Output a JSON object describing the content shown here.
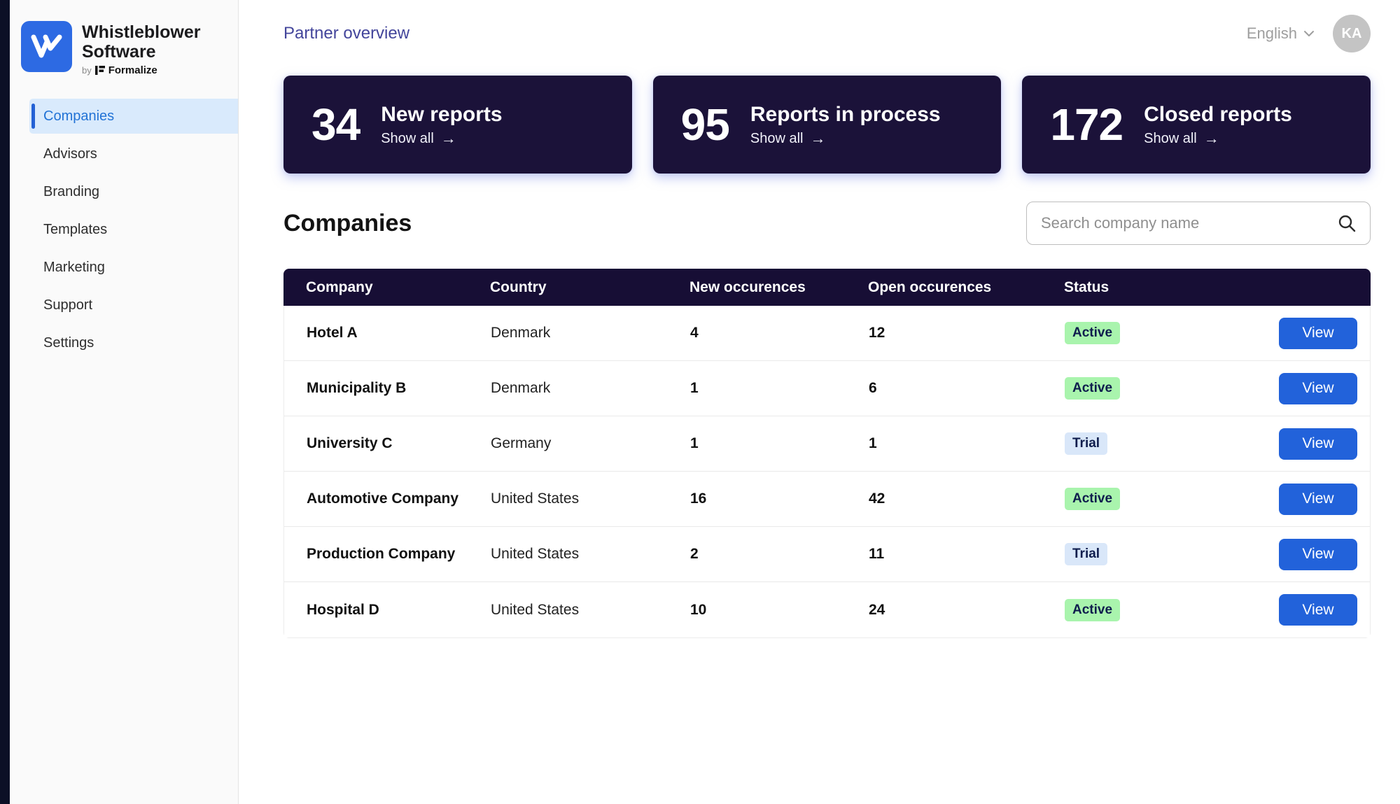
{
  "brand": {
    "name_line1": "Whistleblower",
    "name_line2": "Software",
    "byline_prefix": "by",
    "byline_brand": "Formalize"
  },
  "sidebar": {
    "items": [
      {
        "label": "Companies",
        "active": true
      },
      {
        "label": "Advisors",
        "active": false
      },
      {
        "label": "Branding",
        "active": false
      },
      {
        "label": "Templates",
        "active": false
      },
      {
        "label": "Marketing",
        "active": false
      },
      {
        "label": "Support",
        "active": false
      },
      {
        "label": "Settings",
        "active": false
      }
    ]
  },
  "header": {
    "breadcrumb": "Partner overview",
    "language": "English",
    "avatar_initials": "KA"
  },
  "stats": [
    {
      "value": "34",
      "label": "New reports",
      "link_label": "Show all"
    },
    {
      "value": "95",
      "label": "Reports in process",
      "link_label": "Show all"
    },
    {
      "value": "172",
      "label": "Closed reports",
      "link_label": "Show all"
    }
  ],
  "companies": {
    "title": "Companies",
    "search_placeholder": "Search company name",
    "table": {
      "headers": [
        "Company",
        "Country",
        "New occurences",
        "Open occurences",
        "Status"
      ],
      "view_label": "View",
      "rows": [
        {
          "company": "Hotel A",
          "country": "Denmark",
          "new_occurrences": "4",
          "open_occurrences": "12",
          "status": "Active"
        },
        {
          "company": "Municipality B",
          "country": "Denmark",
          "new_occurrences": "1",
          "open_occurrences": "6",
          "status": "Active"
        },
        {
          "company": "University C",
          "country": "Germany",
          "new_occurrences": "1",
          "open_occurrences": "1",
          "status": "Trial"
        },
        {
          "company": "Automotive Company",
          "country": "United States",
          "new_occurrences": "16",
          "open_occurrences": "42",
          "status": "Active"
        },
        {
          "company": "Production Company",
          "country": "United States",
          "new_occurrences": "2",
          "open_occurrences": "11",
          "status": "Trial"
        },
        {
          "company": "Hospital D",
          "country": "United States",
          "new_occurrences": "10",
          "open_occurrences": "24",
          "status": "Active"
        }
      ]
    }
  },
  "colors": {
    "accent_blue": "#2262da",
    "logo_blue": "#2d6ae3",
    "card_navy": "#1b1239",
    "header_navy": "#170e35",
    "left_strip": "#0c1026",
    "sidebar_bg": "#fafafa",
    "active_item_bg": "#d9eafc",
    "active_item_text": "#2273d6",
    "breadcrumb_text": "#43459b",
    "badge_text": "#0f1d4d",
    "active_badge_bg": "#a9f4ad",
    "trial_badge_bg": "#d9e7f9",
    "avatar_bg": "#c4c4c4"
  }
}
